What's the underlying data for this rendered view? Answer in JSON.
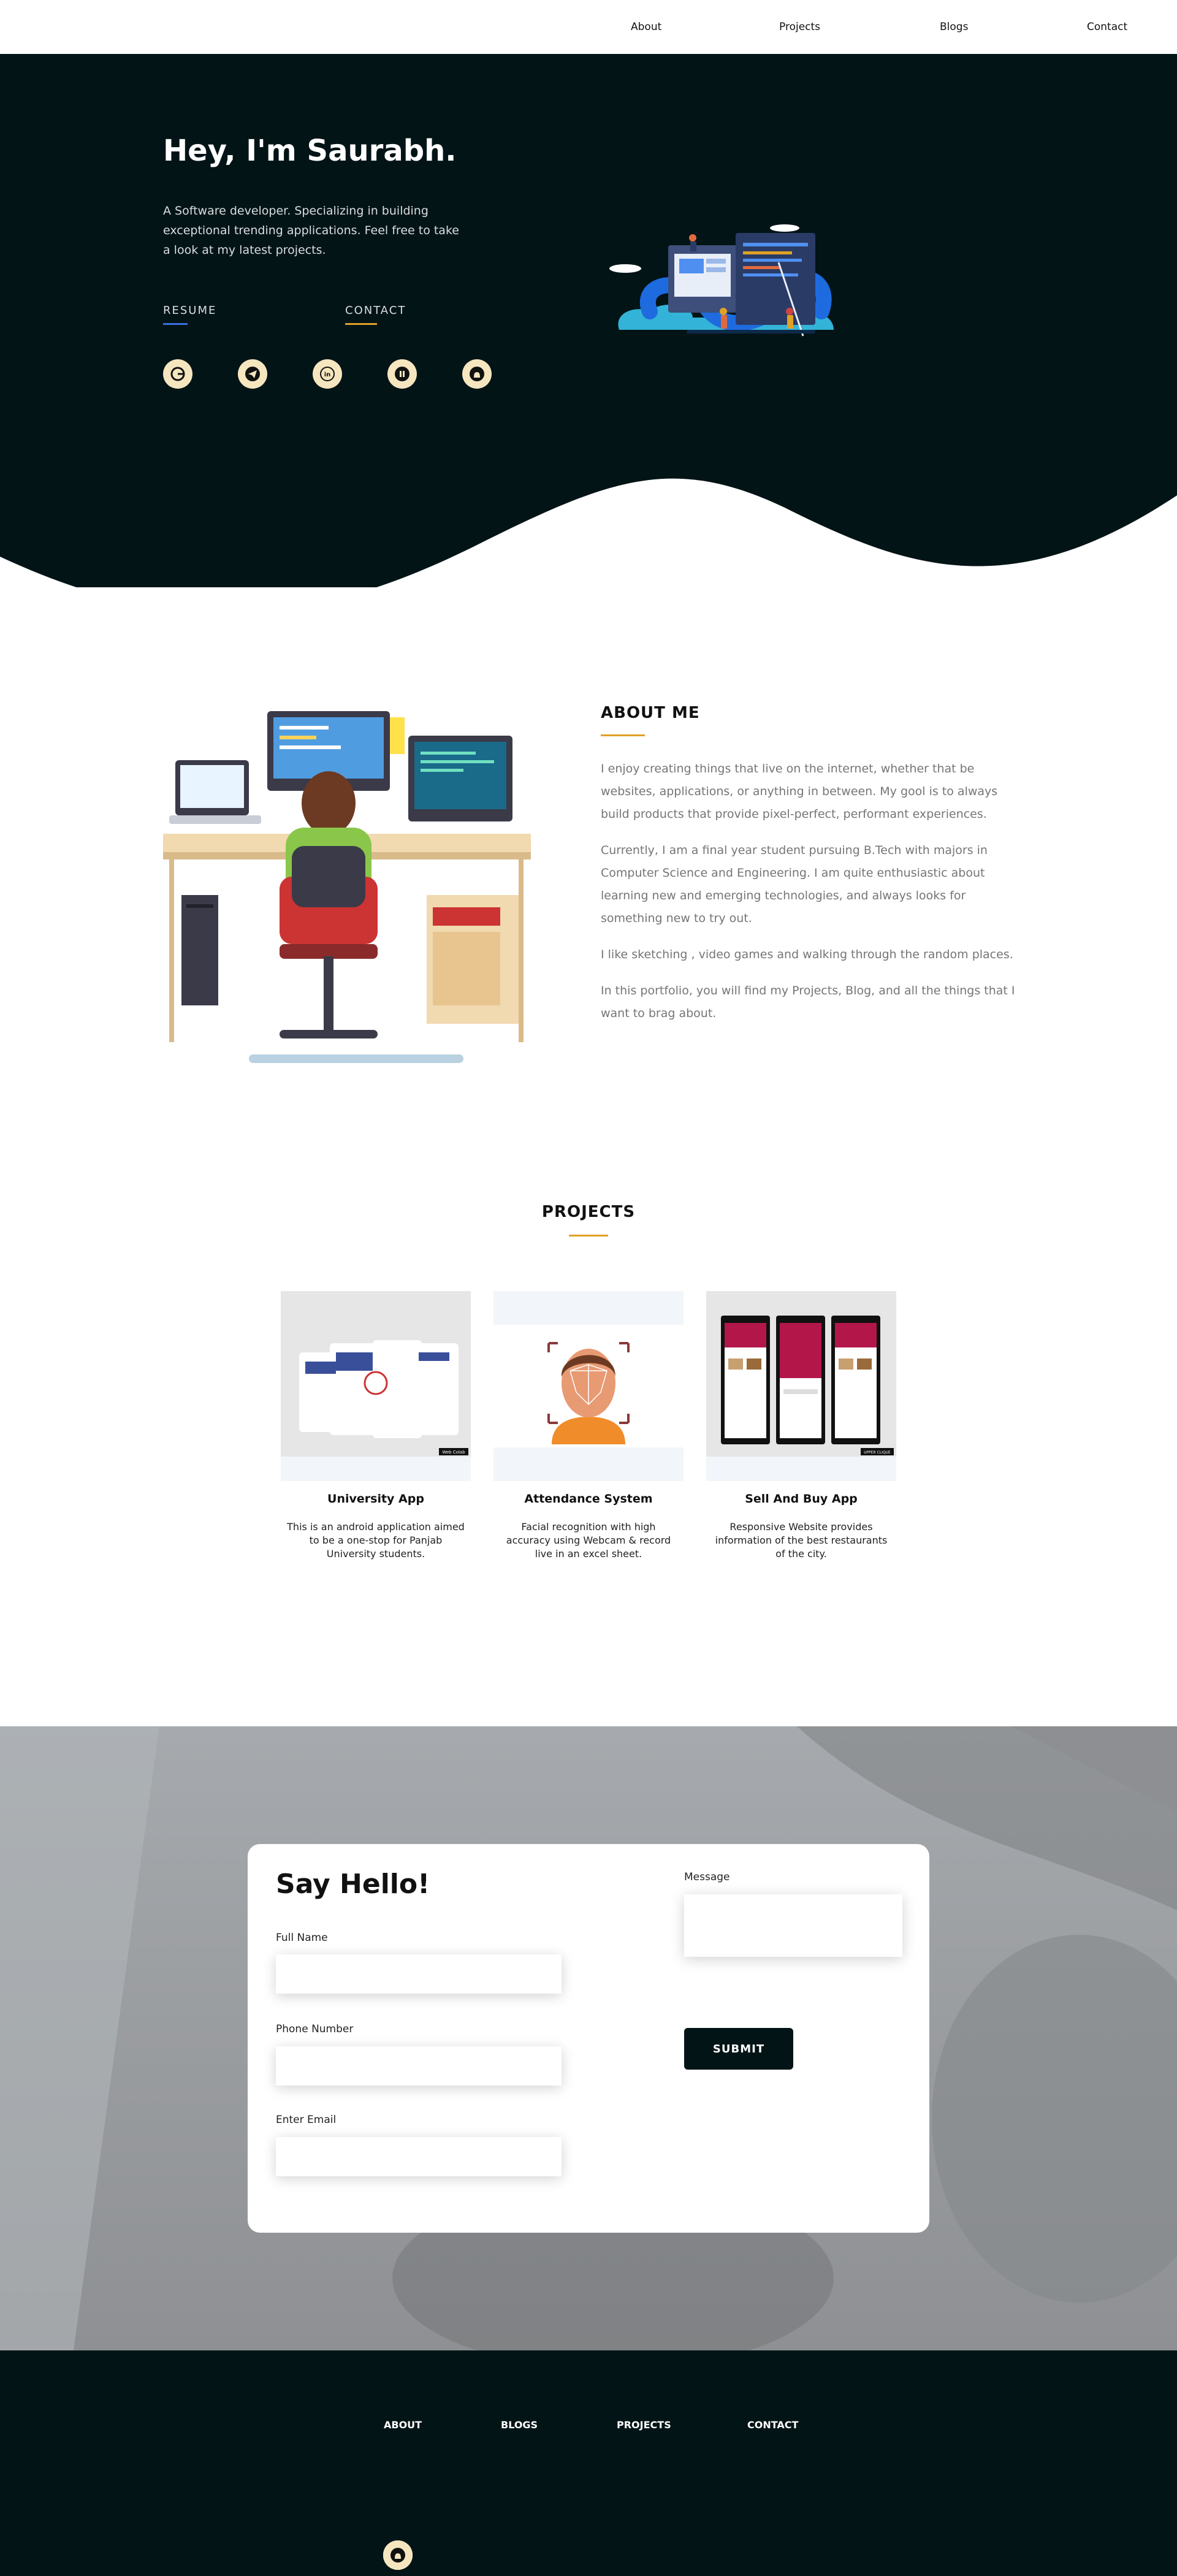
{
  "nav": {
    "items": [
      {
        "label": "About"
      },
      {
        "label": "Projects"
      },
      {
        "label": "Blogs"
      },
      {
        "label": "Contact"
      }
    ]
  },
  "hero": {
    "title": "Hey, I'm Saurabh.",
    "description": "A Software developer. Specializing in building exceptional trending applications. Feel free to take a look at my latest projects.",
    "links": [
      {
        "label": "RESUME",
        "underline_color": "#3b6fe0"
      },
      {
        "label": "CONTACT",
        "underline_color": "#e0a125"
      }
    ],
    "social_icons": [
      "google-icon",
      "telegram-icon",
      "linkedin-icon",
      "hashnode-icon",
      "github-icon"
    ],
    "background_color": "#031417"
  },
  "about": {
    "title": "ABOUT ME",
    "paragraphs": [
      "I enjoy creating things that live on the internet, whether that be websites, applications, or anything in between. My gool is to always build products that provide pixel-perfect, performant experiences.",
      "Currently, I am a final year student pursuing B.Tech with majors in Computer Science and Engineering. I am quite enthusiastic about learning new and emerging technologies, and always looks for something new to try out.",
      "I like sketching , video games and walking through the random places.",
      "In this portfolio, you will find my Projects, Blog, and all the things that I want to brag about."
    ],
    "accent_color": "#e0a125"
  },
  "projects": {
    "title": "PROJECTS",
    "items": [
      {
        "name": "University App",
        "description": "This is an android application aimed to be a one-stop for Panjab University students.",
        "tag": "Web Colab"
      },
      {
        "name": "Attendance System",
        "description": "Facial recognition with high accuracy using Webcam & record live in an excel sheet."
      },
      {
        "name": "Sell And Buy App",
        "description": "Responsive Website provides information of the best restaurants of the city.",
        "tag": "UPPER CLIQUE"
      }
    ]
  },
  "contact": {
    "heading": "Say Hello!",
    "fields": [
      {
        "label": "Full Name",
        "value": ""
      },
      {
        "label": "Phone Number",
        "value": ""
      },
      {
        "label": "Enter Email",
        "value": ""
      }
    ],
    "message_label": "Message",
    "message_value": "",
    "submit_label": "SUBMIT"
  },
  "footer": {
    "links": [
      {
        "label": "ABOUT"
      },
      {
        "label": "BLOGS"
      },
      {
        "label": "PROJECTS"
      },
      {
        "label": "CONTACT"
      }
    ],
    "social_icons": [
      "google-icon",
      "telegram-icon",
      "linkedin-icon",
      "hashnode-icon",
      "github-icon"
    ]
  }
}
